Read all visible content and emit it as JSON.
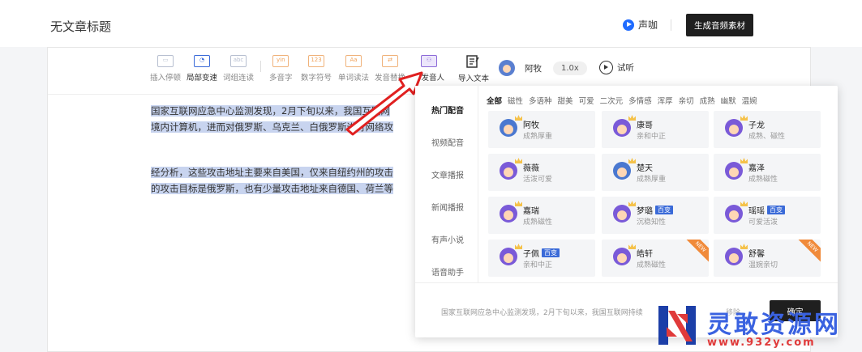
{
  "header": {
    "doc_title": "无文章标题",
    "brand": "声咖",
    "generate_button": "生成音频素材"
  },
  "toolbar": {
    "insert_pause": "插入停顿",
    "local_speed": "局部变速",
    "word_link": "词组连读",
    "polyphone": "多音字",
    "number_symbol": "数字符号",
    "word_read": "单词读法",
    "pronunciation_replace": "发音替换",
    "multi_speaker": "多发音人",
    "import_text": "导入文本",
    "current_voice": "阿牧",
    "speed": "1.0x",
    "audition": "试听"
  },
  "content": {
    "para1_line1": "国家互联网应急中心监测发现，2月下旬以来，我国互联网",
    "para1_line2": "境内计算机，进而对俄罗斯、乌克兰、白俄罗斯进行网络攻",
    "para2_line1": "经分析，这些攻击地址主要来自美国，仅来自纽约州的攻击",
    "para2_line2": "的攻击目标是俄罗斯，也有少量攻击地址来自德国、荷兰等"
  },
  "panel": {
    "categories": [
      "热门配音",
      "视频配音",
      "文章播报",
      "新闻播报",
      "有声小说",
      "语音助手"
    ],
    "filters": [
      "全部",
      "磁性",
      "多语种",
      "甜美",
      "可爱",
      "二次元",
      "多情感",
      "浑厚",
      "亲切",
      "成熟",
      "幽默",
      "温婉"
    ],
    "voices": [
      {
        "name": "阿牧",
        "desc": "成熟厚重",
        "tag": "",
        "badge": ""
      },
      {
        "name": "康哥",
        "desc": "亲和中正",
        "tag": "",
        "badge": ""
      },
      {
        "name": "子龙",
        "desc": "成熟、磁性",
        "tag": "",
        "badge": ""
      },
      {
        "name": "薇薇",
        "desc": "活泼可爱",
        "tag": "",
        "badge": ""
      },
      {
        "name": "楚天",
        "desc": "成熟厚重",
        "tag": "",
        "badge": ""
      },
      {
        "name": "嘉泽",
        "desc": "成熟磁性",
        "tag": "",
        "badge": ""
      },
      {
        "name": "嘉瑞",
        "desc": "成熟磁性",
        "tag": "",
        "badge": ""
      },
      {
        "name": "梦璐",
        "desc": "沉稳知性",
        "tag": "百变",
        "badge": ""
      },
      {
        "name": "瑶瑶",
        "desc": "可爱活泼",
        "tag": "百变",
        "badge": ""
      },
      {
        "name": "子佩",
        "desc": "亲和中正",
        "tag": "百变",
        "badge": ""
      },
      {
        "name": "皓轩",
        "desc": "成熟磁性",
        "tag": "",
        "badge": "NEW"
      },
      {
        "name": "舒馨",
        "desc": "温婉亲切",
        "tag": "",
        "badge": "NEW"
      }
    ],
    "preview_text": "国家互联网应急中心监测发现，2月下旬以来，我国互联网持续",
    "remove_label": "移除",
    "confirm_button": "确定"
  },
  "watermark": {
    "title": "灵敢资源网",
    "url": "www.932y.com"
  },
  "colors": {
    "accent_blue": "#3a6ad8",
    "highlight": "#c8d4ef",
    "arrow_red": "#e02020",
    "button_dark": "#1f1f1f"
  }
}
